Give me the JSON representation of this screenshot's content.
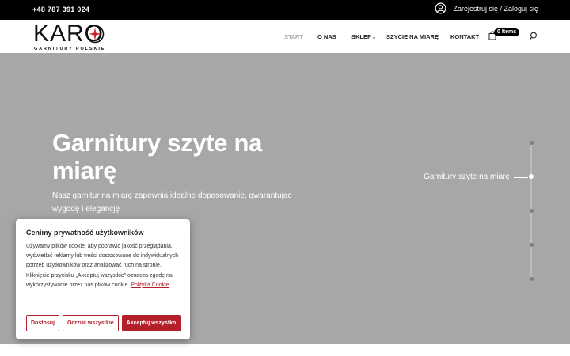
{
  "topbar": {
    "phone": "+48 787 391 024",
    "account_link": "Zarejestruj się / Zaloguj się",
    "user_icon": "user-circle-icon"
  },
  "logo": {
    "word": "KARO",
    "subtitle": "GARNITURY POLSKIE",
    "accent_color": "#c8252d"
  },
  "nav": {
    "items": [
      {
        "label": "START",
        "active": true
      },
      {
        "label": "O NAS"
      },
      {
        "label": "SKLEP",
        "has_dropdown": true
      },
      {
        "label": "SZYCIE NA MIARĘ"
      },
      {
        "label": "KONTAKT"
      }
    ],
    "cart_badge": "0 Items",
    "cart_icon": "cart-icon",
    "search_icon": "search-icon"
  },
  "hero": {
    "title": "Garnitury szyte na miarę",
    "text": "Nasz garnitur na miarę zapewnia idealne dopasowanie, gwarantując wygodę i elegancję",
    "slide_label": "Garnitury szyte na miarę",
    "background_color": "#a7a7a9"
  },
  "cookie": {
    "title": "Cenimy prywatność użytkowników",
    "body": "Używamy plików cookie, aby poprawić jakość przeglądania, wyświetlać reklamy lub treści dostosowane do indywidualnych potrzeb użytkowników oraz analizować ruch na stronie. Kliknięcie przycisku „Akceptuj wszystkie” oznacza zgodę na wykorzystywanie przez nas plików cookie.",
    "link": "Polityka Cookie",
    "buttons": {
      "customize": "Dostosuj",
      "reject": "Odrzuć wszystkie",
      "accept": "Akceptuj wszystko"
    },
    "accent_color": "#b3202a"
  }
}
